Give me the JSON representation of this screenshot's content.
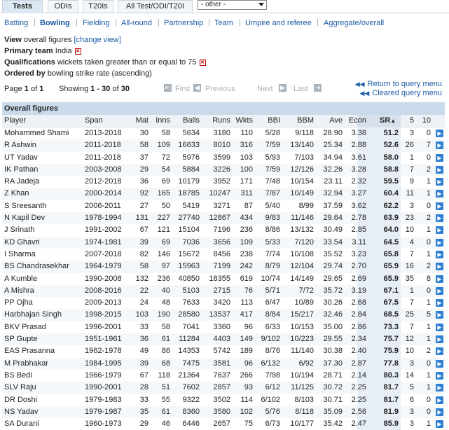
{
  "tabs": [
    "Tests",
    "ODIs",
    "T20Is",
    "All Test/ODI/T20I"
  ],
  "format_select": "- other -",
  "subnav": [
    "Batting",
    "Bowling",
    "Fielding",
    "All-round",
    "Partnership",
    "Team",
    "Umpire and referee",
    "Aggregate/overall"
  ],
  "info": {
    "view_label": "View",
    "view_text": "overall figures",
    "change_view": "[change view]",
    "team_label": "Primary team",
    "team_value": "India",
    "qual_label": "Qualifications",
    "qual_value": "wickets taken greater than or equal to 75",
    "order_label": "Ordered by",
    "order_value": "bowling strike rate (ascending)"
  },
  "pager": {
    "page_text": "Page",
    "page_cur": "1",
    "of_text": "of",
    "page_total": "1",
    "showing_text": "Showing",
    "range": "1 - 30",
    "of2": "of",
    "total": "30",
    "first": "First",
    "previous": "Previous",
    "next": "Next",
    "last": "Last",
    "return_link": "Return to query menu",
    "cleared_link": "Cleared query menu"
  },
  "table": {
    "caption": "Overall figures",
    "headers": [
      "Player",
      "Span",
      "Mat",
      "Inns",
      "Balls",
      "Runs",
      "Wkts",
      "BBI",
      "BBM",
      "Ave",
      "Econ",
      "SR",
      "5",
      "10"
    ],
    "sort_indicator": "▲",
    "rows": [
      [
        "Mohammed Shami",
        "2013-2018",
        "30",
        "58",
        "5634",
        "3180",
        "110",
        "5/28",
        "9/118",
        "28.90",
        "3.38",
        "51.2",
        "3",
        "0"
      ],
      [
        "R Ashwin",
        "2011-2018",
        "58",
        "109",
        "16633",
        "8010",
        "316",
        "7/59",
        "13/140",
        "25.34",
        "2.88",
        "52.6",
        "26",
        "7"
      ],
      [
        "UT Yadav",
        "2011-2018",
        "37",
        "72",
        "5976",
        "3599",
        "103",
        "5/93",
        "7/103",
        "34.94",
        "3.61",
        "58.0",
        "1",
        "0"
      ],
      [
        "IK Pathan",
        "2003-2008",
        "29",
        "54",
        "5884",
        "3226",
        "100",
        "7/59",
        "12/126",
        "32.26",
        "3.28",
        "58.8",
        "7",
        "2"
      ],
      [
        "RA Jadeja",
        "2012-2018",
        "36",
        "69",
        "10179",
        "3952",
        "171",
        "7/48",
        "10/154",
        "23.11",
        "2.32",
        "59.5",
        "9",
        "1"
      ],
      [
        "Z Khan",
        "2000-2014",
        "92",
        "165",
        "18785",
        "10247",
        "311",
        "7/87",
        "10/149",
        "32.94",
        "3.27",
        "60.4",
        "11",
        "1"
      ],
      [
        "S Sreesanth",
        "2006-2011",
        "27",
        "50",
        "5419",
        "3271",
        "87",
        "5/40",
        "8/99",
        "37.59",
        "3.62",
        "62.2",
        "3",
        "0"
      ],
      [
        "N Kapil Dev",
        "1978-1994",
        "131",
        "227",
        "27740",
        "12867",
        "434",
        "9/83",
        "11/146",
        "29.64",
        "2.78",
        "63.9",
        "23",
        "2"
      ],
      [
        "J Srinath",
        "1991-2002",
        "67",
        "121",
        "15104",
        "7196",
        "236",
        "8/86",
        "13/132",
        "30.49",
        "2.85",
        "64.0",
        "10",
        "1"
      ],
      [
        "KD Ghavri",
        "1974-1981",
        "39",
        "69",
        "7036",
        "3656",
        "109",
        "5/33",
        "7/120",
        "33.54",
        "3.11",
        "64.5",
        "4",
        "0"
      ],
      [
        "I Sharma",
        "2007-2018",
        "82",
        "146",
        "15672",
        "8456",
        "238",
        "7/74",
        "10/108",
        "35.52",
        "3.23",
        "65.8",
        "7",
        "1"
      ],
      [
        "BS Chandrasekhar",
        "1964-1979",
        "58",
        "97",
        "15963",
        "7199",
        "242",
        "8/79",
        "12/104",
        "29.74",
        "2.70",
        "65.9",
        "16",
        "2"
      ],
      [
        "A Kumble",
        "1990-2008",
        "132",
        "236",
        "40850",
        "18355",
        "619",
        "10/74",
        "14/149",
        "29.65",
        "2.69",
        "65.9",
        "35",
        "8"
      ],
      [
        "A Mishra",
        "2008-2016",
        "22",
        "40",
        "5103",
        "2715",
        "76",
        "5/71",
        "7/72",
        "35.72",
        "3.19",
        "67.1",
        "1",
        "0"
      ],
      [
        "PP Ojha",
        "2009-2013",
        "24",
        "48",
        "7633",
        "3420",
        "113",
        "6/47",
        "10/89",
        "30.26",
        "2.68",
        "67.5",
        "7",
        "1"
      ],
      [
        "Harbhajan Singh",
        "1998-2015",
        "103",
        "190",
        "28580",
        "13537",
        "417",
        "8/84",
        "15/217",
        "32.46",
        "2.84",
        "68.5",
        "25",
        "5"
      ],
      [
        "BKV Prasad",
        "1996-2001",
        "33",
        "58",
        "7041",
        "3360",
        "96",
        "6/33",
        "10/153",
        "35.00",
        "2.86",
        "73.3",
        "7",
        "1"
      ],
      [
        "SP Gupte",
        "1951-1961",
        "36",
        "61",
        "11284",
        "4403",
        "149",
        "9/102",
        "10/223",
        "29.55",
        "2.34",
        "75.7",
        "12",
        "1"
      ],
      [
        "EAS Prasanna",
        "1962-1978",
        "49",
        "86",
        "14353",
        "5742",
        "189",
        "8/76",
        "11/140",
        "30.38",
        "2.40",
        "75.9",
        "10",
        "2"
      ],
      [
        "M Prabhakar",
        "1984-1995",
        "39",
        "68",
        "7475",
        "3581",
        "96",
        "6/132",
        "6/92",
        "37.30",
        "2.87",
        "77.8",
        "3",
        "0"
      ],
      [
        "BS Bedi",
        "1966-1979",
        "67",
        "118",
        "21364",
        "7637",
        "266",
        "7/98",
        "10/194",
        "28.71",
        "2.14",
        "80.3",
        "14",
        "1"
      ],
      [
        "SLV Raju",
        "1990-2001",
        "28",
        "51",
        "7602",
        "2857",
        "93",
        "6/12",
        "11/125",
        "30.72",
        "2.25",
        "81.7",
        "5",
        "1"
      ],
      [
        "DR Doshi",
        "1979-1983",
        "33",
        "55",
        "9322",
        "3502",
        "114",
        "6/102",
        "8/103",
        "30.71",
        "2.25",
        "81.7",
        "6",
        "0"
      ],
      [
        "NS Yadav",
        "1979-1987",
        "35",
        "61",
        "8360",
        "3580",
        "102",
        "5/76",
        "8/118",
        "35.09",
        "2.56",
        "81.9",
        "3",
        "0"
      ],
      [
        "SA Durani",
        "1960-1973",
        "29",
        "46",
        "6446",
        "2657",
        "75",
        "6/73",
        "10/177",
        "35.42",
        "2.47",
        "85.9",
        "3",
        "1"
      ]
    ]
  }
}
